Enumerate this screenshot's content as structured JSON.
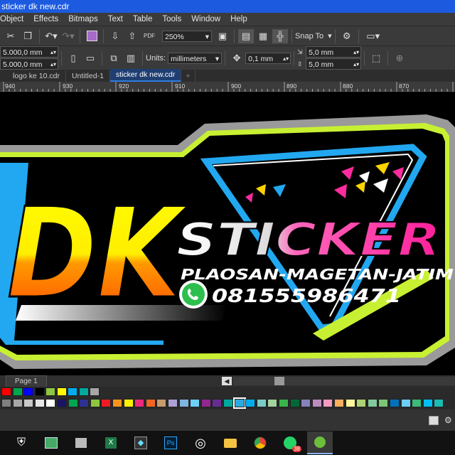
{
  "window": {
    "title": "sticker dk new.cdr"
  },
  "menu": {
    "items": [
      "Object",
      "Effects",
      "Bitmaps",
      "Text",
      "Table",
      "Tools",
      "Window",
      "Help"
    ]
  },
  "toolbar": {
    "zoom": "250%",
    "snap_label": "Snap To"
  },
  "propbar": {
    "width": "5.000,0 mm",
    "height": "5.000,0 mm",
    "units_label": "Units:",
    "units_value": "millimeters",
    "nudge": "0,1 mm",
    "dup_x": "5,0 mm",
    "dup_y": "5,0 mm"
  },
  "tabs": [
    {
      "label": "logo ke 10.cdr"
    },
    {
      "label": "Untitled-1"
    },
    {
      "label": "sticker dk new.cdr"
    }
  ],
  "ruler": {
    "labels": [
      "940",
      "930",
      "920",
      "910",
      "900",
      "890",
      "880",
      "870"
    ]
  },
  "artwork": {
    "brand_big": "DK",
    "brand_word": "STICKER",
    "location": "PLAOSAN-MAGETAN-JATIM",
    "phone": "081555986471"
  },
  "pagebar": {
    "page_tab": "Page 1"
  },
  "palette": {
    "row1": [
      "#ff0000",
      "#00a651",
      "#0000ff",
      "#000000",
      "#8dc63f",
      "#ffff00",
      "#00aeef",
      "#00a99d",
      "#a6a6a6"
    ],
    "row2": [
      "#7f7f7f",
      "#a6a6a6",
      "#c8c8c8",
      "#e6e6e6",
      "#ffffff",
      "#1b1464",
      "#00a651",
      "#2e3192",
      "#8dc63f",
      "#ed1c24",
      "#f7941d",
      "#fff200",
      "#ee2a7b",
      "#f26522",
      "#c69c6d",
      "#aba0d5",
      "#7fb3e0",
      "#6dcff6",
      "#92278f",
      "#662d91",
      "#00a99d",
      "#29abe2",
      "#00aeef",
      "#7accc8",
      "#a3d39c",
      "#39b54a",
      "#006838",
      "#8781bd",
      "#bd8cbf",
      "#f49ac1",
      "#fbaf5d",
      "#fff799",
      "#acd373",
      "#82ca9c",
      "#7cc576",
      "#0072bc",
      "#6dcff6",
      "#3cb878",
      "#00bff3",
      "#1cbbb4"
    ],
    "selected_index": 21
  },
  "taskbar": {
    "badge": "38"
  }
}
